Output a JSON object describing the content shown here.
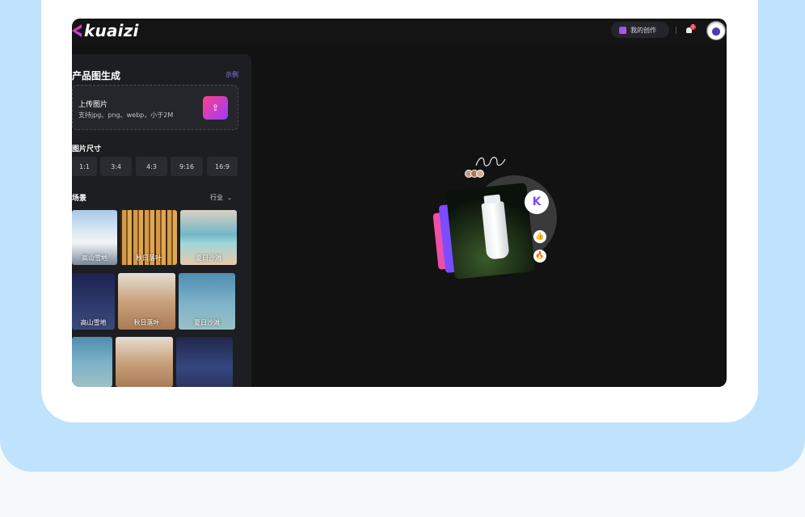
{
  "header": {
    "brand": "kuaizi",
    "create_label": "我的创作",
    "notification_count": "1"
  },
  "sidebar": {
    "title": "产品图生成",
    "example_link": "示例",
    "upload": {
      "title": "上传图片",
      "hint": "支持jpg、png、webp，小于2M"
    },
    "size_title": "图片尺寸",
    "ratios": [
      "1:1",
      "3:4",
      "4:3",
      "9:16",
      "16:9"
    ],
    "scene_title": "场景",
    "industry_label": "行业",
    "scenes": [
      "高山雪地",
      "秋日落叶",
      "夏日沙滩",
      "高山雪地",
      "秋日落叶",
      "夏日沙滩",
      "",
      "",
      ""
    ]
  },
  "colors": {
    "accent_gradient_start": "#ff3f8a",
    "accent_gradient_end": "#9b3cff",
    "panel_bg": "#121212",
    "outer_blue": "#bfe2fd"
  }
}
